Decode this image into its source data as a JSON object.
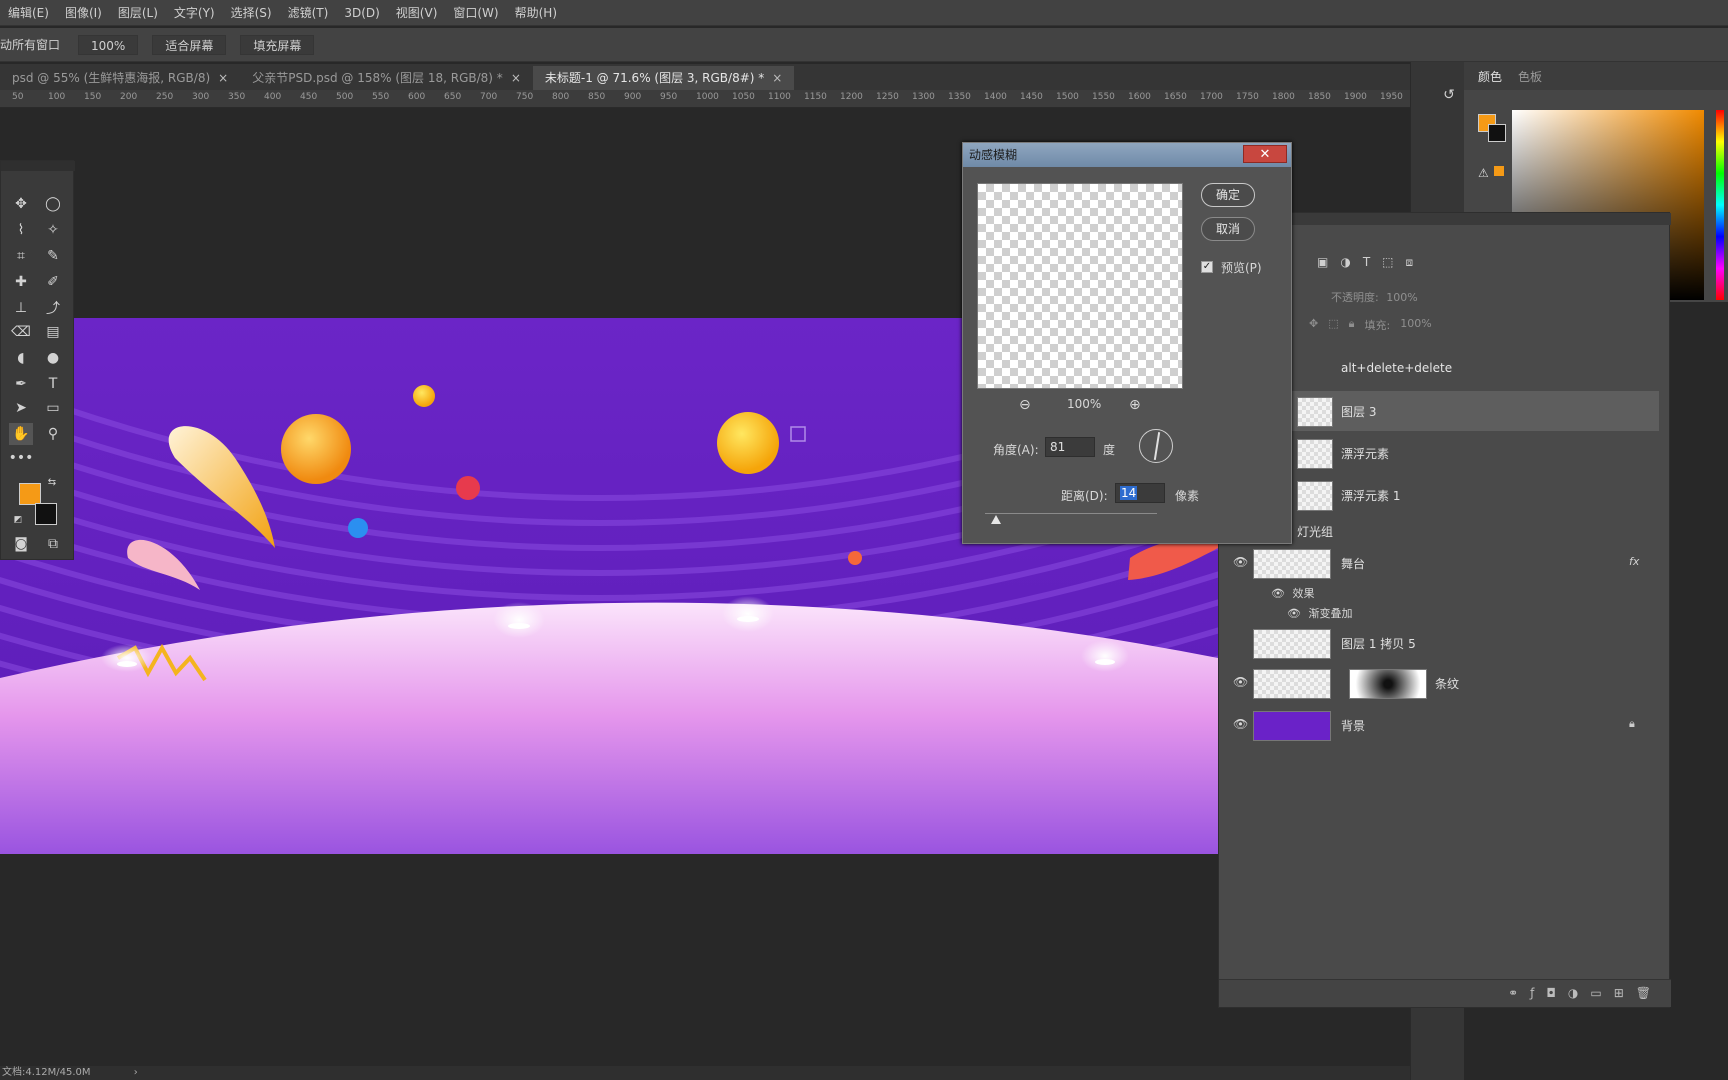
{
  "menu": [
    "编辑(E)",
    "图像(I)",
    "图层(L)",
    "文字(Y)",
    "选择(S)",
    "滤镜(T)",
    "3D(D)",
    "视图(V)",
    "窗口(W)",
    "帮助(H)"
  ],
  "options": {
    "scroll_all": "动所有窗口",
    "zoom": "100%",
    "fit_screen": "适合屏幕",
    "fill_screen": "填充屏幕"
  },
  "tabs": [
    {
      "label": "psd @ 55% (生鲜特惠海报, RGB/8)",
      "close": "×"
    },
    {
      "label": "父亲节PSD.psd @ 158% (图层 18, RGB/8) *",
      "close": "×"
    },
    {
      "label": "未标题-1 @ 71.6% (图层 3, RGB/8#) *",
      "close": "×"
    }
  ],
  "ruler_ticks": [
    "50",
    "100",
    "150",
    "200",
    "250",
    "300",
    "350",
    "400",
    "450",
    "500",
    "550",
    "600",
    "650",
    "700",
    "750",
    "800",
    "850",
    "900",
    "950",
    "1000",
    "1050",
    "1100",
    "1150",
    "1200",
    "1250",
    "1300",
    "1350",
    "1400",
    "1450",
    "1500",
    "1550",
    "1600",
    "1650",
    "1700",
    "1750",
    "1800",
    "1850",
    "1900",
    "1950"
  ],
  "dialog": {
    "title": "动感模糊",
    "close": "✕",
    "ok": "确定",
    "cancel": "取消",
    "preview_label": "预览(P)",
    "preview_checked": true,
    "zoom_level": "100%",
    "angle_label": "角度(A):",
    "angle_value": "81",
    "angle_unit": "度",
    "distance_label": "距离(D):",
    "distance_value": "14",
    "distance_unit": "像素"
  },
  "layers_panel": {
    "opacity_label": "不透明度:",
    "opacity_value": "100%",
    "fill_label": "填充:",
    "fill_value": "100%",
    "note": "alt+delete+delete",
    "layers": [
      {
        "name": "图层 3",
        "active": true
      },
      {
        "name": "漂浮元素",
        "active": false
      },
      {
        "name": "漂浮元素 1",
        "active": false
      }
    ],
    "group_label": "灯光组",
    "stage_layer": "舞台",
    "fx": "fx",
    "effects_label": "效果",
    "gradient_overlay": "渐变叠加",
    "copy_layer": "图层 1 拷贝 5",
    "stripes_layer": "条纹",
    "background_layer": "背景"
  },
  "color_panel": {
    "tab1": "颜色",
    "tab2": "色板",
    "fg_color": "#f59a16",
    "bg_color": "#111111"
  },
  "status": {
    "doc": "文档:4.12M/45.0M",
    "arrow": "›"
  },
  "colors": {
    "banner_purple": "#6a22c8",
    "stage_pink": "#f6b8f4",
    "ball_yellow": "#f7c21a"
  }
}
